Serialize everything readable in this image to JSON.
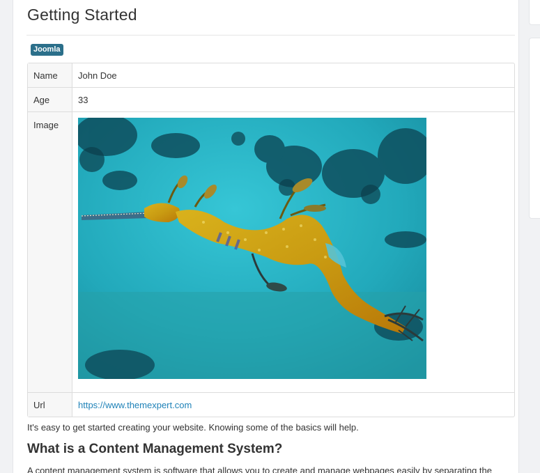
{
  "article": {
    "title": "Getting Started",
    "tag": "Joomla",
    "fields": [
      {
        "label": "Name",
        "value": "John Doe"
      },
      {
        "label": "Age",
        "value": "33"
      },
      {
        "label": "Image",
        "value": ""
      },
      {
        "label": "Url",
        "value": "https://www.themexpert.com"
      }
    ],
    "image_icon": "weedy-seadragon-photo",
    "intro": "It's easy to get started creating your website. Knowing some of the basics will help.",
    "heading": "What is a Content Management System?",
    "body": "A content management system is software that allows you to create and manage webpages easily by separating the"
  },
  "colors": {
    "tag_bg": "#2b6f8a",
    "link": "#1f82b8",
    "water": "#2bb3c4"
  }
}
